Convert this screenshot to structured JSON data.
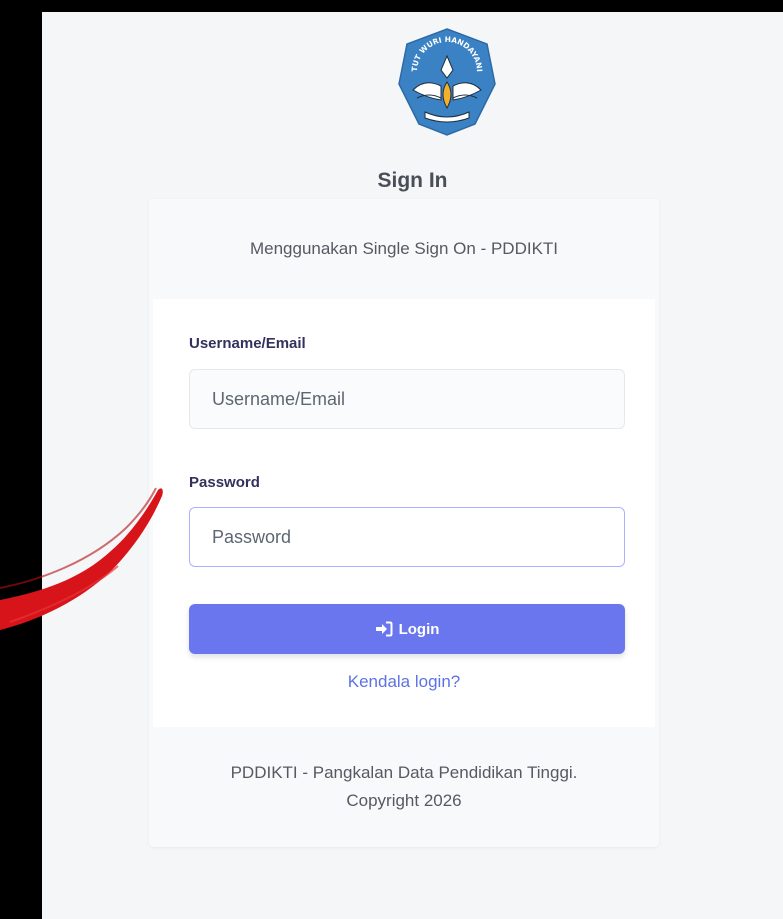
{
  "header": {
    "title": "Sign In"
  },
  "card": {
    "subtitle": "Menggunakan Single Sign On - PDDIKTI"
  },
  "form": {
    "username": {
      "label": "Username/Email",
      "placeholder": "Username/Email",
      "value": ""
    },
    "password": {
      "label": "Password",
      "placeholder": "Password",
      "value": ""
    },
    "login_button": {
      "label": "Login",
      "icon": "sign-in-icon"
    },
    "help_link": "Kendala login?"
  },
  "footer": {
    "line1": "PDDIKTI - Pangkalan Data Pendidikan Tinggi.",
    "line2": "Copyright 2026"
  },
  "logo": {
    "icon": "tut-wuri-handayani-emblem-icon",
    "motto": "TUT WURI HANDAYANI"
  },
  "colors": {
    "accent": "#6a76ee",
    "link": "#5e72e4",
    "emblem_blue": "#3b82c4",
    "annotation_red": "#d7141a"
  }
}
